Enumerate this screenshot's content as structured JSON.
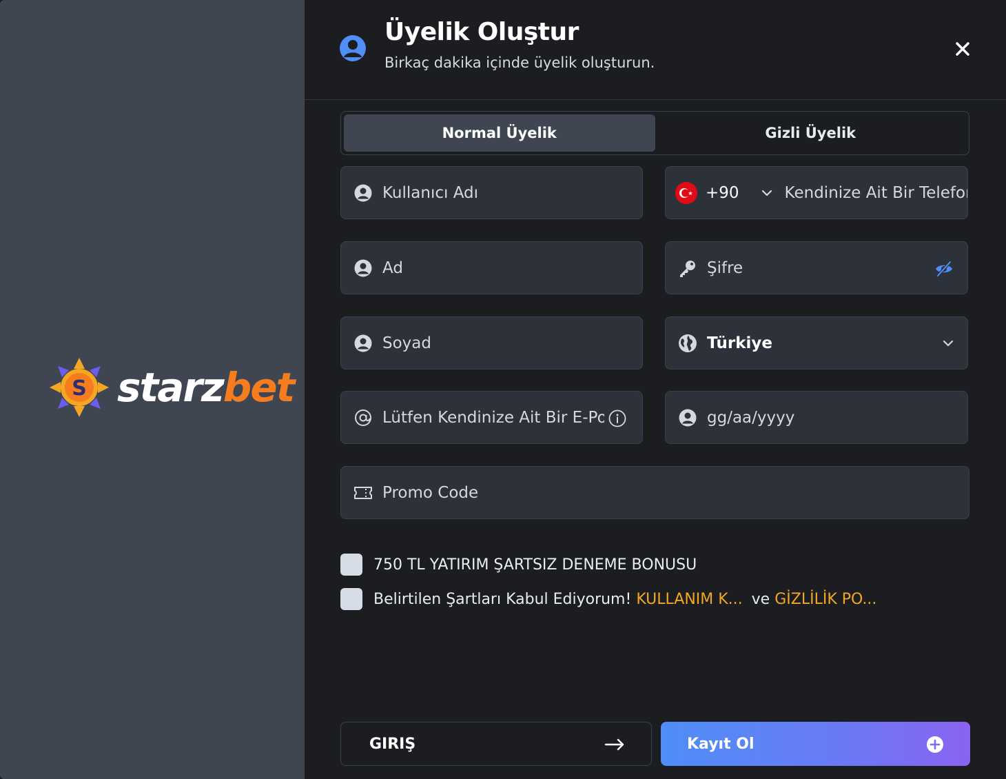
{
  "brand": {
    "word1": "starz",
    "word2": "bet"
  },
  "header": {
    "title": "Üyelik Oluştur",
    "subtitle": "Birkaç dakika içinde üyelik oluşturun."
  },
  "tabs": [
    {
      "label": "Normal Üyelik",
      "active": true
    },
    {
      "label": "Gizli Üyelik",
      "active": false
    }
  ],
  "form": {
    "username_placeholder": "Kullanıcı Adı",
    "phone_country_code": "+90",
    "phone_placeholder": "Kendinize Ait Bir Telefon",
    "first_name_placeholder": "Ad",
    "password_placeholder": "Şifre",
    "last_name_placeholder": "Soyad",
    "country_value": "Türkiye",
    "email_placeholder": "Lütfen Kendinize Ait Bir E-Pos",
    "birthdate_placeholder": "gg/aa/yyyy",
    "promo_placeholder": "Promo Code"
  },
  "checkboxes": {
    "bonus_label": "750 TL YATIRIM ŞARTSIZ DENEME BONUSU",
    "terms_prefix": "Belirtilen Şartları Kabul Ediyorum!",
    "terms_link": "KULLANIM K...",
    "terms_and": "ve",
    "privacy_link": "GİZLİLİK PO..."
  },
  "buttons": {
    "login_label": "GIRIŞ",
    "register_label": "Kayıt Ol"
  },
  "colors": {
    "accent_blue": "#4f8ef7",
    "accent_purple": "#8b63f1",
    "link_orange": "#f5a623",
    "brand_orange": "#f57c1f"
  }
}
